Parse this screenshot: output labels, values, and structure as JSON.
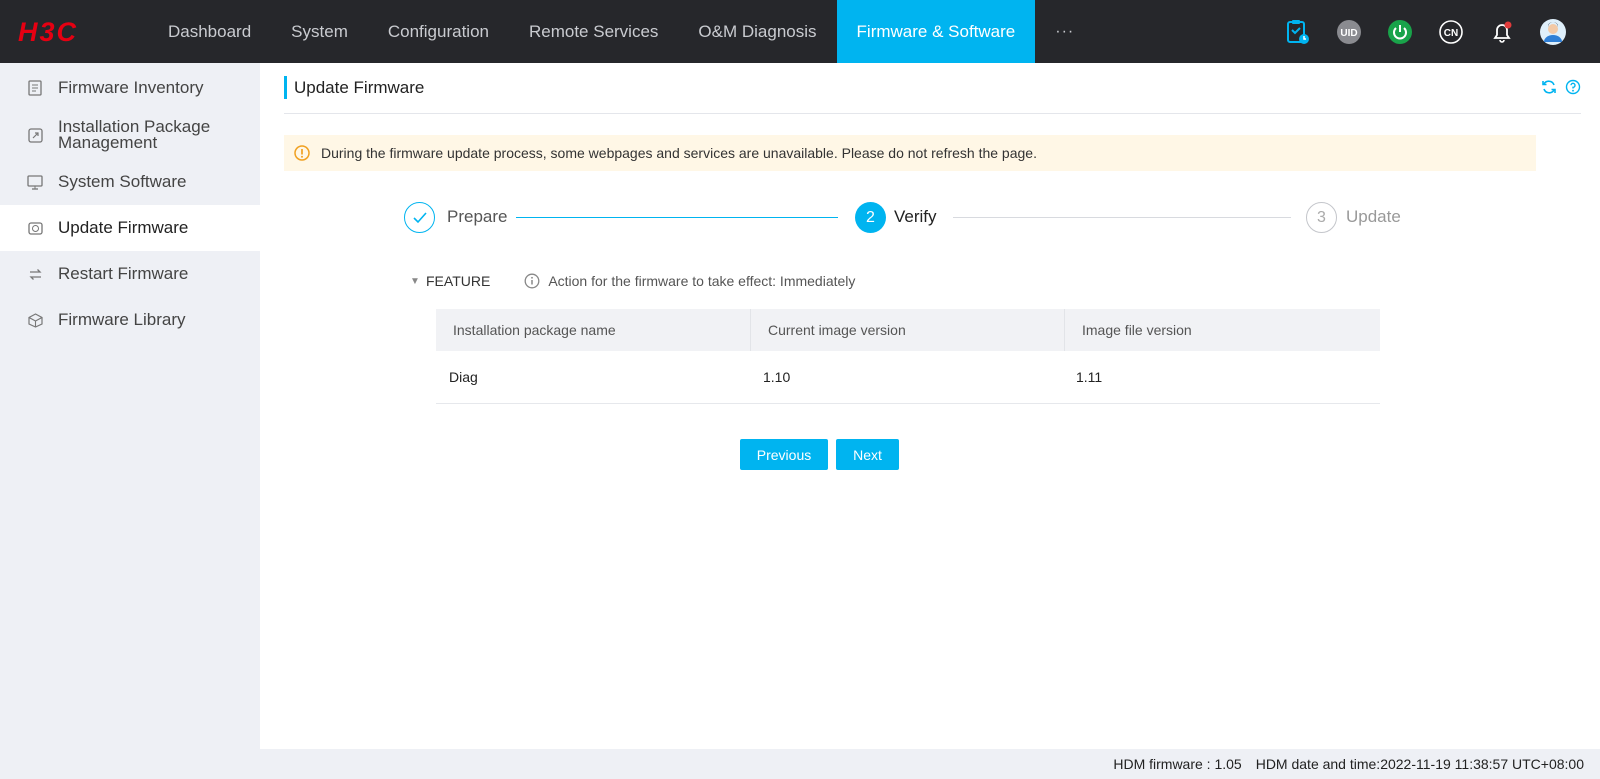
{
  "brand": {
    "logo_text": "H3C",
    "logo_color": "#e60012"
  },
  "colors": {
    "accent": "#00b4f0",
    "topbar_bg": "#26272b",
    "notice_bg": "#fff7e6",
    "warning": "#f0a020",
    "power_green": "#19a34a",
    "alert_red": "#e23b3b"
  },
  "nav": {
    "items": [
      {
        "label": "Dashboard"
      },
      {
        "label": "System"
      },
      {
        "label": "Configuration"
      },
      {
        "label": "Remote Services"
      },
      {
        "label": "O&M Diagnosis"
      },
      {
        "label": "Firmware & Software",
        "active": true
      },
      {
        "label": "···"
      }
    ],
    "icons": [
      "task-clipboard-icon",
      "uid-icon",
      "power-icon",
      "language-cn-icon",
      "bell-icon",
      "user-avatar-icon"
    ],
    "uid_label": "UID",
    "lang_label": "CN"
  },
  "sidebar": {
    "items": [
      {
        "label": "Firmware Inventory",
        "icon": "inventory-icon"
      },
      {
        "label": "Installation Package Management",
        "icon": "package-icon"
      },
      {
        "label": "System Software",
        "icon": "monitor-icon"
      },
      {
        "label": "Update Firmware",
        "icon": "update-icon",
        "active": true
      },
      {
        "label": "Restart Firmware",
        "icon": "restart-icon"
      },
      {
        "label": "Firmware Library",
        "icon": "library-icon"
      }
    ]
  },
  "page": {
    "title": "Update Firmware",
    "head_icons": [
      "refresh-icon",
      "help-icon"
    ],
    "notice": "During the firmware update process, some webpages and services are unavailable. Please do not refresh the page."
  },
  "stepper": {
    "steps": [
      {
        "number": "1",
        "label": "Prepare",
        "state": "done"
      },
      {
        "number": "2",
        "label": "Verify",
        "state": "active"
      },
      {
        "number": "3",
        "label": "Update",
        "state": "pending"
      }
    ]
  },
  "feature": {
    "label": "FEATURE",
    "effect_text": "Action for the firmware to take effect: Immediately"
  },
  "table": {
    "columns": [
      "Installation package name",
      "Current image version",
      "Image file version"
    ],
    "rows": [
      [
        "Diag",
        "1.10",
        "1.11"
      ]
    ]
  },
  "buttons": {
    "previous": "Previous",
    "next": "Next"
  },
  "footer": {
    "firmware": "HDM firmware : 1.05",
    "datetime": "HDM date and time:2022-11-19 11:38:57 UTC+08:00"
  }
}
